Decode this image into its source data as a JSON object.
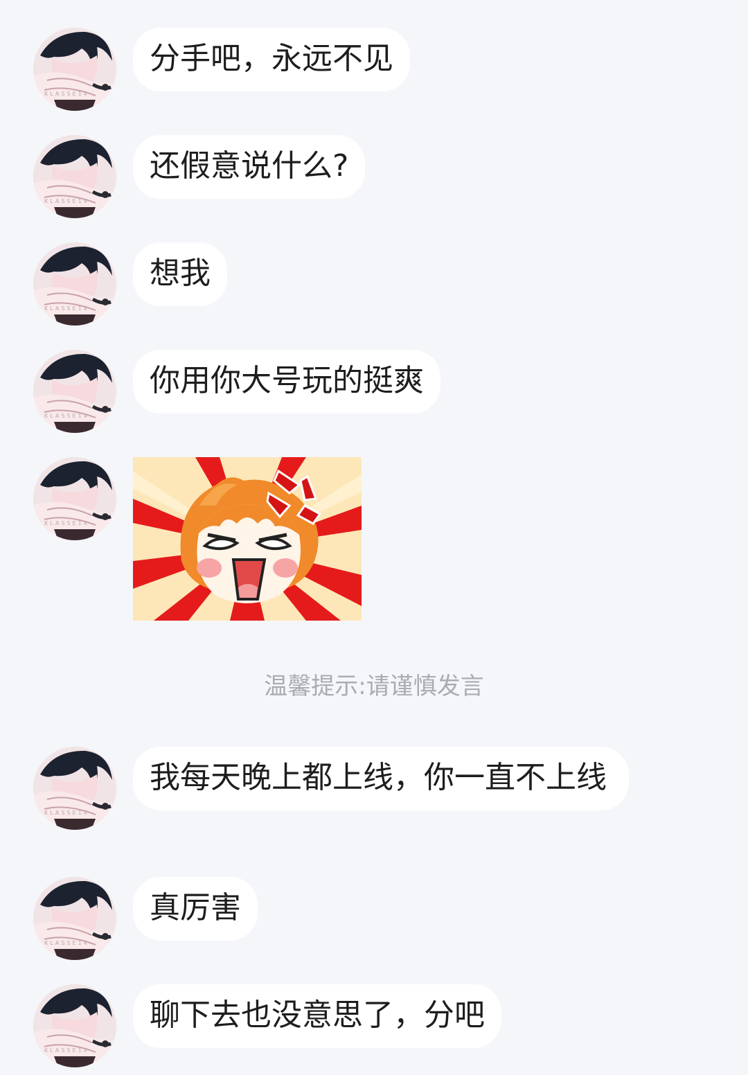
{
  "chat": {
    "avatar_icon": "user-avatar-anime",
    "messages": [
      {
        "type": "text",
        "text": "分手吧，永远不见"
      },
      {
        "type": "text",
        "text": "还假意说什么?"
      },
      {
        "type": "text",
        "text": "想我"
      },
      {
        "type": "text",
        "text": "你用你大号玩的挺爽"
      },
      {
        "type": "sticker",
        "sticker_icon": "angry-chibi-sticker"
      },
      {
        "type": "text",
        "text": "我每天晚上都上线，你一直不上线"
      },
      {
        "type": "text",
        "text": "真厉害"
      },
      {
        "type": "text",
        "text": "聊下去也没意思了，分吧"
      }
    ],
    "system_tip": "温馨提示:请谨慎发言"
  },
  "colors": {
    "background": "#f4f6f9",
    "bubble": "#ffffff",
    "text": "#1d1d1d",
    "tip_text": "#a9acb2"
  }
}
